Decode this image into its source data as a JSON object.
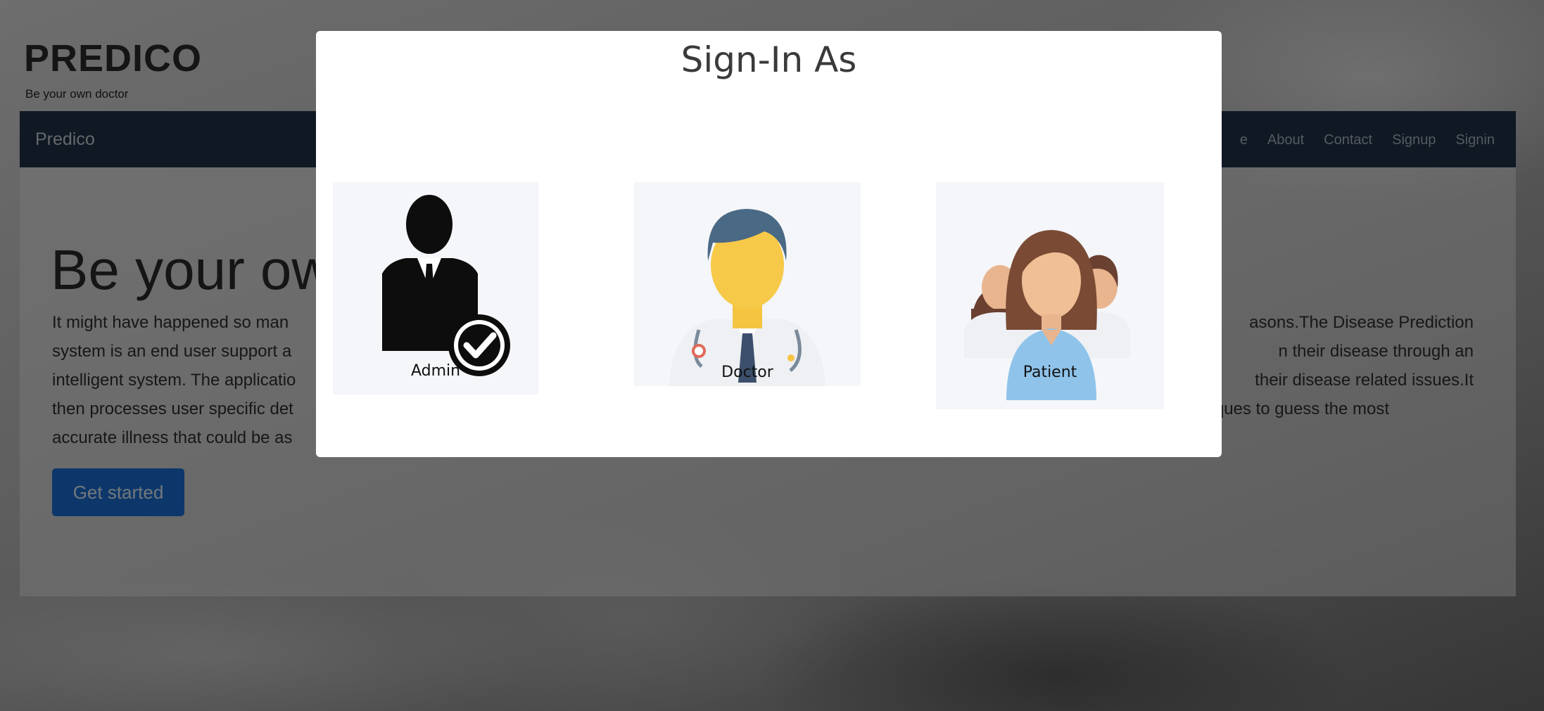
{
  "site": {
    "title": "PREDICO",
    "tagline": "Be your own doctor"
  },
  "navbar": {
    "brand": "Predico",
    "links": [
      "e",
      "About",
      "Contact",
      "Signup",
      "Signin"
    ]
  },
  "hero": {
    "title": "Be your ow",
    "text_lines": [
      "It might have happened so man",
      "system is an end user support a",
      "intelligent system. The applicatio",
      "then processes user specific det",
      "accurate illness that could be as"
    ],
    "text_right_lines": [
      "asons.The Disease Prediction",
      "n their disease through an",
      "their disease related issues.It",
      "iques to guess the most",
      ""
    ],
    "button_label": "Get started"
  },
  "modal": {
    "title": "Sign-In As",
    "roles": [
      {
        "label": "Admin",
        "icon": "admin-icon"
      },
      {
        "label": "Doctor",
        "icon": "doctor-icon"
      },
      {
        "label": "Patient",
        "icon": "patient-icon"
      }
    ]
  },
  "colors": {
    "navbar": "#1f3047",
    "button": "#1a6fd4",
    "backdrop": "rgba(0,0,0,0.5)"
  }
}
